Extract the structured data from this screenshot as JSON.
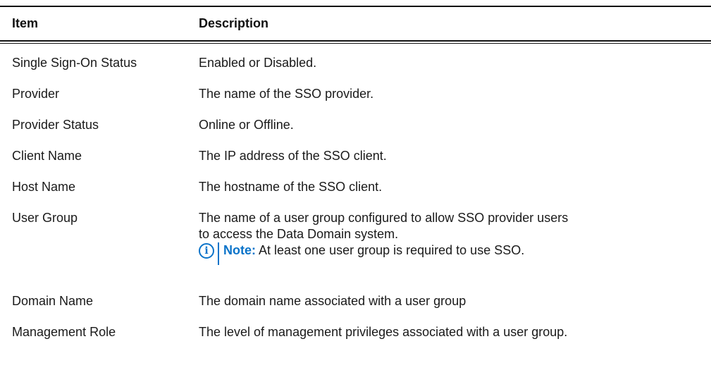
{
  "table": {
    "headers": {
      "item": "Item",
      "description": "Description"
    },
    "rows": [
      {
        "item": "Single Sign-On Status",
        "description": "Enabled or Disabled."
      },
      {
        "item": "Provider",
        "description": "The name of the SSO provider."
      },
      {
        "item": "Provider Status",
        "description": "Online or Offline."
      },
      {
        "item": "Client Name",
        "description": "The IP address of the SSO client."
      },
      {
        "item": "Host Name",
        "description": "The hostname of the SSO client."
      },
      {
        "item": "User Group",
        "description_line1": "The name of a user group configured to allow SSO provider users",
        "description_line2": "to access the Data Domain system.",
        "note_label": "Note:",
        "note_text": " At least one user group is required to use SSO."
      },
      {
        "item": "Domain Name",
        "description": "The domain name associated with a user group"
      },
      {
        "item": "Management Role",
        "description": "The level of management privileges associated with a user group."
      }
    ]
  },
  "colors": {
    "note_accent": "#0a73c9",
    "rule": "#111111"
  },
  "icons": {
    "note": "info-icon"
  }
}
